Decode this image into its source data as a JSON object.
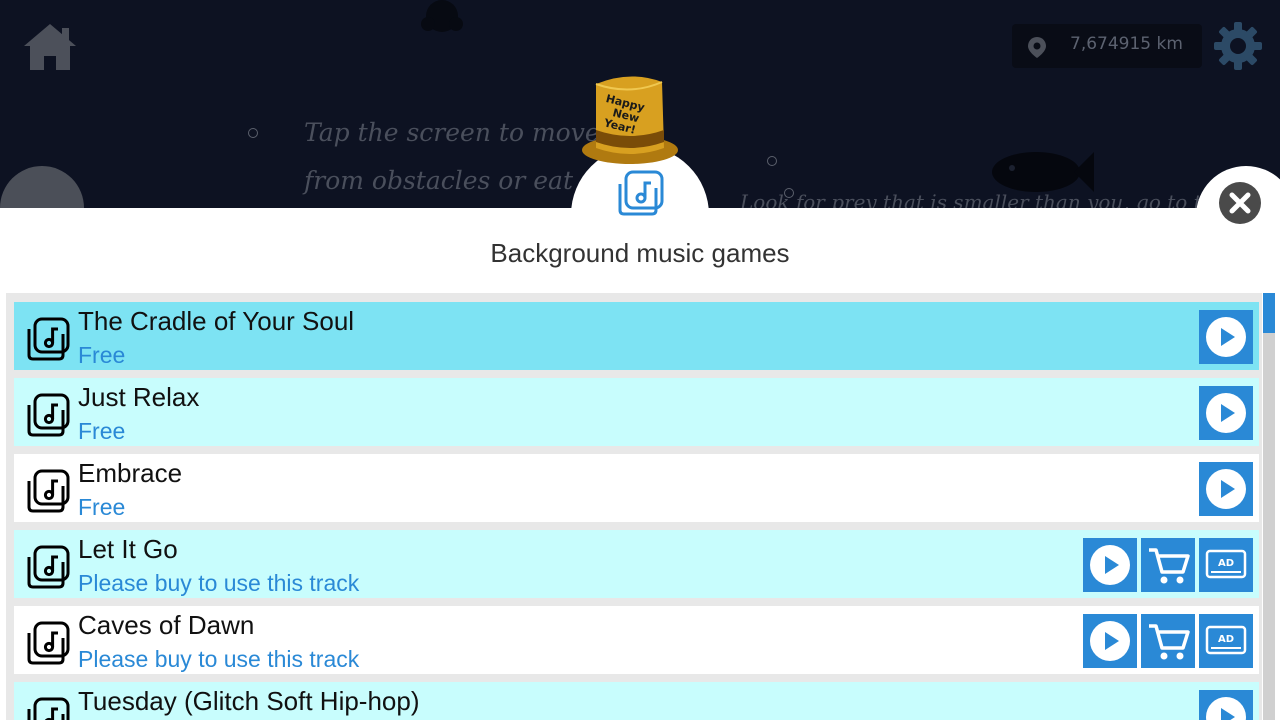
{
  "hud": {
    "distance": "7,674915 km",
    "home_icon": "home-icon",
    "settings_icon": "gear-icon"
  },
  "tips": {
    "line1": "Tap the screen to move fish",
    "line2": "from obstacles  or eat foo",
    "line3": "Look for prey that is smaller than you, go to the n"
  },
  "dialog": {
    "title": "Background music games",
    "hat_text": [
      "Happy",
      "New",
      "Year!"
    ],
    "close_icon": "close-icon"
  },
  "colors": {
    "accent": "#2a89d6",
    "selected_row": "#7de3f3",
    "alt_row": "#c8fdfd",
    "plain_row": "#ffffff"
  },
  "tracks": [
    {
      "name": "The Cradle of Your Soul",
      "status": "Free",
      "selected": true,
      "owned": true
    },
    {
      "name": "Just Relax",
      "status": "Free",
      "selected": false,
      "owned": true
    },
    {
      "name": "Embrace",
      "status": "Free",
      "selected": false,
      "owned": true
    },
    {
      "name": "Let It Go",
      "status": "Please buy to use this track",
      "selected": false,
      "owned": false
    },
    {
      "name": "Caves of Dawn",
      "status": "Please buy to use this track",
      "selected": false,
      "owned": false
    },
    {
      "name": "Tuesday (Glitch Soft Hip-hop)",
      "status": "",
      "selected": false,
      "owned": true
    }
  ],
  "buttons": {
    "ad_label": "AD"
  }
}
